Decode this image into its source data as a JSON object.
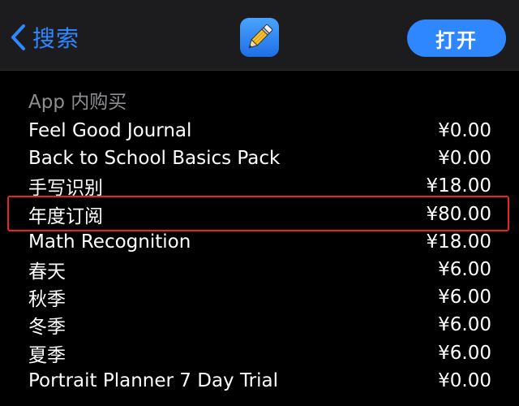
{
  "navbar": {
    "back_label": "搜索",
    "open_label": "打开",
    "app_icon": "pencil-app-icon"
  },
  "in_app_purchases": {
    "section_title": "App 内购买",
    "items": [
      {
        "name": "Feel Good Journal",
        "price": "¥0.00"
      },
      {
        "name": "Back to School Basics Pack",
        "price": "¥0.00"
      },
      {
        "name": "手写识别",
        "price": "¥18.00"
      },
      {
        "name": "年度订阅",
        "price": "¥80.00",
        "highlighted": true
      },
      {
        "name": "Math Recognition",
        "price": "¥18.00"
      },
      {
        "name": "春天",
        "price": "¥6.00"
      },
      {
        "name": "秋季",
        "price": "¥6.00"
      },
      {
        "name": "冬季",
        "price": "¥6.00"
      },
      {
        "name": "夏季",
        "price": "¥6.00"
      },
      {
        "name": "Portrait Planner 7 Day Trial",
        "price": "¥0.00"
      }
    ]
  },
  "colors": {
    "accent": "#2f87ff",
    "background": "#000000",
    "navbar": "#1c1c1e",
    "secondary_text": "#8e8e93",
    "highlight": "#e8232a"
  }
}
